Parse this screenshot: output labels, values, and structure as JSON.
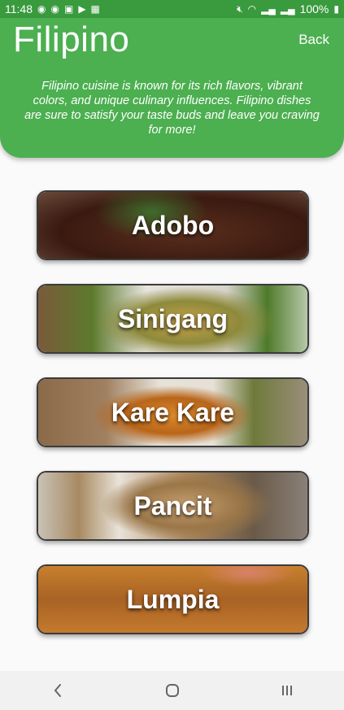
{
  "status": {
    "time": "11:48",
    "battery": "100%"
  },
  "header": {
    "title": "Filipino",
    "back_label": "Back",
    "description": "Filipino cuisine is known for its rich flavors, vibrant colors, and unique culinary influences. Filipino dishes are sure to satisfy your taste buds and leave you craving for more!"
  },
  "dishes": [
    {
      "label": "Adobo"
    },
    {
      "label": "Sinigang"
    },
    {
      "label": "Kare Kare"
    },
    {
      "label": "Pancit"
    },
    {
      "label": "Lumpia"
    }
  ],
  "colors": {
    "header_green": "#4caf50",
    "status_green": "#3a9a3e"
  }
}
